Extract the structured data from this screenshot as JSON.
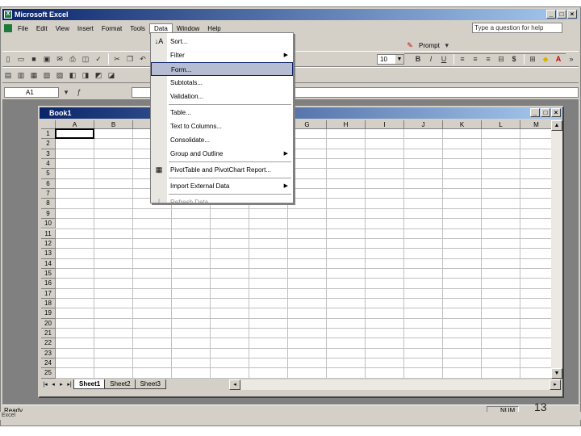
{
  "window": {
    "title": "Microsoft Excel",
    "min": "_",
    "max": "□",
    "close": "×"
  },
  "menubar": {
    "items": [
      "File",
      "Edit",
      "View",
      "Insert",
      "Format",
      "Tools",
      "Data",
      "Window",
      "Help"
    ],
    "ask_placeholder": "Type a question for help"
  },
  "toolbar": {
    "prompt_label": "Prompt",
    "font_size": "10",
    "bold": "B",
    "italic": "I",
    "underline": "U",
    "currency": "$"
  },
  "formula_bar": {
    "name_box": "A1"
  },
  "workbook": {
    "title": "Book1",
    "columns": [
      "A",
      "B",
      "C",
      "D",
      "E",
      "F",
      "G",
      "H",
      "I",
      "J",
      "K",
      "L",
      "M"
    ],
    "rows": [
      "1",
      "2",
      "3",
      "4",
      "5",
      "6",
      "7",
      "8",
      "9",
      "10",
      "11",
      "12",
      "13",
      "14",
      "15",
      "16",
      "17",
      "18",
      "19",
      "20",
      "21",
      "22",
      "23",
      "24",
      "25"
    ],
    "sheets": [
      "Sheet1",
      "Sheet2",
      "Sheet3"
    ],
    "active_sheet": "Sheet1"
  },
  "data_menu": {
    "items": [
      {
        "label": "Sort...",
        "icon": "sort-icon",
        "glyph": "↓A"
      },
      {
        "label": "Filter",
        "submenu": true
      },
      {
        "label": "Form...",
        "highlighted": true
      },
      {
        "label": "Subtotals..."
      },
      {
        "label": "Validation..."
      },
      {
        "label": "Table..."
      },
      {
        "label": "Text to Columns..."
      },
      {
        "label": "Consolidate..."
      },
      {
        "label": "Group and Outline",
        "submenu": true
      },
      {
        "label": "PivotTable and PivotChart Report...",
        "icon": "pivot-icon",
        "glyph": "▦"
      },
      {
        "label": "Import External Data",
        "submenu": true
      },
      {
        "label": "Refresh Data",
        "disabled": true,
        "icon": "refresh-icon",
        "glyph": "!"
      }
    ]
  },
  "status": {
    "text": "Ready",
    "num": "NUM"
  },
  "taskbar": {
    "text": "Excel"
  },
  "slide_number": "13"
}
